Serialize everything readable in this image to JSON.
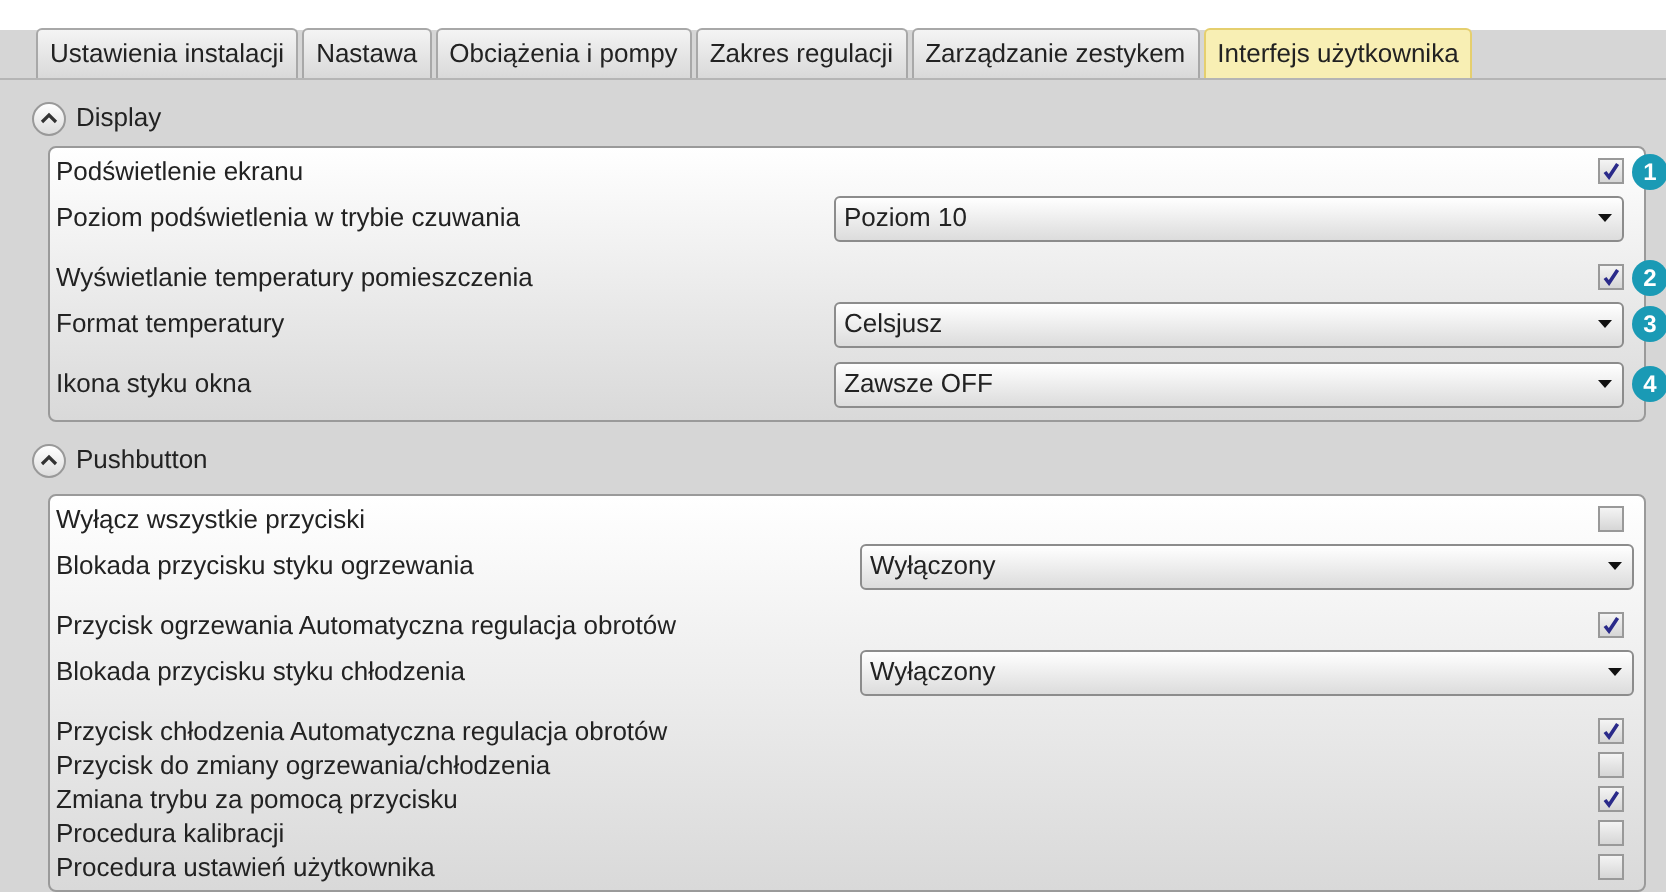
{
  "tabs": [
    {
      "label": "Ustawienia instalacji",
      "selected": false
    },
    {
      "label": "Nastawa",
      "selected": false
    },
    {
      "label": "Obciążenia i pompy",
      "selected": false
    },
    {
      "label": "Zakres regulacji",
      "selected": false
    },
    {
      "label": "Zarządzanie zestykem",
      "selected": false
    },
    {
      "label": "Interfejs użytkownika",
      "selected": true
    }
  ],
  "sections": [
    {
      "title": "Display",
      "expanded": true,
      "rows": [
        {
          "kind": "checkbox",
          "label": "Podświetlenie ekranu",
          "checked": true,
          "callout": "1"
        },
        {
          "kind": "dropdown",
          "label": "Poziom podświetlenia w trybie czuwania",
          "value": "Poziom 10"
        },
        {
          "kind": "checkbox",
          "label": "Wyświetlanie temperatury pomieszczenia",
          "checked": true,
          "callout": "2"
        },
        {
          "kind": "dropdown",
          "label": "Format temperatury",
          "value": "Celsjusz",
          "callout": "3"
        },
        {
          "kind": "dropdown",
          "label": "Ikona styku okna",
          "value": "Zawsze OFF",
          "callout": "4"
        }
      ]
    },
    {
      "title": "Pushbutton",
      "expanded": true,
      "rows": [
        {
          "kind": "checkbox",
          "label": "Wyłącz wszystkie przyciski",
          "checked": false
        },
        {
          "kind": "dropdown",
          "label": "Blokada przycisku styku ogrzewania",
          "value": "Wyłączony"
        },
        {
          "kind": "checkbox",
          "label": "Przycisk ogrzewania Automatyczna regulacja obrotów",
          "checked": true
        },
        {
          "kind": "dropdown",
          "label": "Blokada przycisku styku chłodzenia",
          "value": "Wyłączony"
        },
        {
          "kind": "checkbox",
          "label": "Przycisk chłodzenia Automatyczna regulacja obrotów",
          "checked": true
        },
        {
          "kind": "checkbox",
          "label": "Przycisk do zmiany ogrzewania/chłodzenia",
          "checked": false
        },
        {
          "kind": "checkbox",
          "label": "Zmiana trybu za pomocą przycisku",
          "checked": true
        },
        {
          "kind": "checkbox",
          "label": "Procedura kalibracji",
          "checked": false
        },
        {
          "kind": "checkbox",
          "label": "Procedura ustawień użytkownika",
          "checked": false
        }
      ]
    }
  ]
}
